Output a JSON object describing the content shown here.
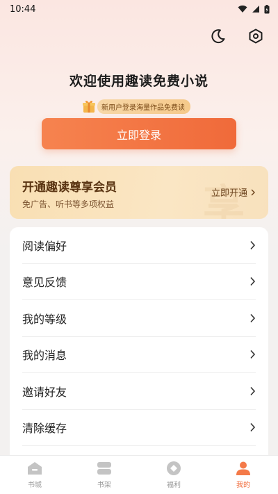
{
  "status_bar": {
    "time": "10:44"
  },
  "header": {
    "night_mode_icon": "moon-icon",
    "settings_icon": "settings-hexagon-icon"
  },
  "login": {
    "headline": "欢迎使用趣读免费小说",
    "promo": "新用户登录海量作品免费读",
    "button_label": "立即登录"
  },
  "vip": {
    "title": "开通趣读尊享会员",
    "subtitle": "免广告、听书等多项权益",
    "action_label": "立即开通",
    "watermark": "享"
  },
  "menu": {
    "items": [
      {
        "label": "阅读偏好"
      },
      {
        "label": "意见反馈"
      },
      {
        "label": "我的等级"
      },
      {
        "label": "我的消息"
      },
      {
        "label": "邀请好友"
      },
      {
        "label": "清除缓存"
      }
    ]
  },
  "tabs": [
    {
      "label": "书城",
      "icon": "home-icon"
    },
    {
      "label": "书架",
      "icon": "bookshelf-icon"
    },
    {
      "label": "福利",
      "icon": "gift-icon"
    },
    {
      "label": "我的",
      "icon": "profile-icon"
    }
  ],
  "colors": {
    "accent": "#f06a3a",
    "vip_gold": "#f9dfb3",
    "inactive": "#9a9a9a"
  }
}
